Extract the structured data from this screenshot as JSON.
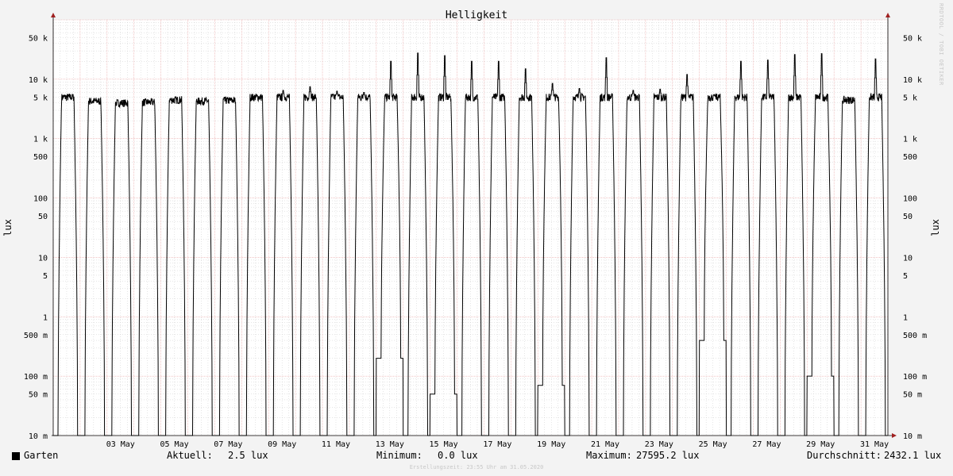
{
  "chart_data": {
    "type": "line",
    "title": "Helligkeit",
    "ylabel_left": "lux",
    "ylabel_right": "lux",
    "y_scale": "log",
    "ylim": [
      0.01,
      100000
    ],
    "y_ticks": [
      {
        "value": 0.01,
        "label": "10 m"
      },
      {
        "value": 0.05,
        "label": "50 m"
      },
      {
        "value": 0.1,
        "label": "100 m"
      },
      {
        "value": 0.5,
        "label": "500 m"
      },
      {
        "value": 1,
        "label": "1"
      },
      {
        "value": 5,
        "label": "5"
      },
      {
        "value": 10,
        "label": "10"
      },
      {
        "value": 50,
        "label": "50"
      },
      {
        "value": 100,
        "label": "100"
      },
      {
        "value": 500,
        "label": "500"
      },
      {
        "value": 1000,
        "label": "1 k"
      },
      {
        "value": 5000,
        "label": "5 k"
      },
      {
        "value": 10000,
        "label": "10 k"
      },
      {
        "value": 50000,
        "label": "50 k"
      }
    ],
    "x_start": "2020-05-01",
    "x_end": "2020-06-01",
    "x_ticks": [
      "03 May",
      "05 May",
      "07 May",
      "09 May",
      "11 May",
      "13 May",
      "15 May",
      "17 May",
      "19 May",
      "21 May",
      "23 May",
      "25 May",
      "27 May",
      "29 May",
      "31 May"
    ],
    "grid": true,
    "series": [
      {
        "name": "Garten",
        "color": "#000000",
        "daily": [
          {
            "date": "2020-05-01",
            "peak_lux": 5000,
            "night_lux": 0.01
          },
          {
            "date": "2020-05-02",
            "peak_lux": 4300,
            "night_lux": 0.01
          },
          {
            "date": "2020-05-03",
            "peak_lux": 4000,
            "night_lux": 0.01
          },
          {
            "date": "2020-05-04",
            "peak_lux": 4100,
            "night_lux": 0.01
          },
          {
            "date": "2020-05-05",
            "peak_lux": 4500,
            "night_lux": 0.01
          },
          {
            "date": "2020-05-06",
            "peak_lux": 4300,
            "night_lux": 0.01
          },
          {
            "date": "2020-05-07",
            "peak_lux": 4400,
            "night_lux": 0.01
          },
          {
            "date": "2020-05-08",
            "peak_lux": 5000,
            "night_lux": 0.01
          },
          {
            "date": "2020-05-09",
            "peak_lux": 6500,
            "night_lux": 0.01
          },
          {
            "date": "2020-05-10",
            "peak_lux": 7500,
            "night_lux": 0.01
          },
          {
            "date": "2020-05-11",
            "peak_lux": 6300,
            "night_lux": 0.01
          },
          {
            "date": "2020-05-12",
            "peak_lux": 6000,
            "night_lux": 0.01
          },
          {
            "date": "2020-05-13",
            "peak_lux": 20000,
            "night_lux": 0.2
          },
          {
            "date": "2020-05-14",
            "peak_lux": 27595.2,
            "night_lux": 0.01
          },
          {
            "date": "2020-05-15",
            "peak_lux": 25000,
            "night_lux": 0.05
          },
          {
            "date": "2020-05-16",
            "peak_lux": 20000,
            "night_lux": 0.01
          },
          {
            "date": "2020-05-17",
            "peak_lux": 20000,
            "night_lux": 0.01
          },
          {
            "date": "2020-05-18",
            "peak_lux": 15000,
            "night_lux": 0.01
          },
          {
            "date": "2020-05-19",
            "peak_lux": 8500,
            "night_lux": 0.07
          },
          {
            "date": "2020-05-20",
            "peak_lux": 7000,
            "night_lux": 0.01
          },
          {
            "date": "2020-05-21",
            "peak_lux": 23000,
            "night_lux": 0.01
          },
          {
            "date": "2020-05-22",
            "peak_lux": 6500,
            "night_lux": 0.01
          },
          {
            "date": "2020-05-23",
            "peak_lux": 6800,
            "night_lux": 0.01
          },
          {
            "date": "2020-05-24",
            "peak_lux": 12000,
            "night_lux": 0.01
          },
          {
            "date": "2020-05-25",
            "peak_lux": 5500,
            "night_lux": 0.4
          },
          {
            "date": "2020-05-26",
            "peak_lux": 20000,
            "night_lux": 0.01
          },
          {
            "date": "2020-05-27",
            "peak_lux": 21000,
            "night_lux": 0.01
          },
          {
            "date": "2020-05-28",
            "peak_lux": 26000,
            "night_lux": 0.01
          },
          {
            "date": "2020-05-29",
            "peak_lux": 27000,
            "night_lux": 0.1
          },
          {
            "date": "2020-05-30",
            "peak_lux": 4500,
            "night_lux": 0.01
          },
          {
            "date": "2020-05-31",
            "peak_lux": 22000,
            "night_lux": 0.01
          }
        ]
      }
    ]
  },
  "legend": {
    "series_name": "Garten",
    "aktuell_label": "Aktuell:",
    "aktuell_value": "2.5 lux",
    "minimum_label": "Minimum:",
    "minimum_value": "0.0 lux",
    "maximum_label": "Maximum:",
    "maximum_value": "27595.2 lux",
    "durchschnitt_label": "Durchschnitt:",
    "durchschnitt_value": "2432.1 lux"
  },
  "footer": {
    "creation_time": "Erstellungszeit: 23:55 Uhr am 31.05.2020"
  },
  "watermark": "RRDTOOL / TOBI OETIKER",
  "colors": {
    "background": "#f3f3f3",
    "plot_background": "#ffffff",
    "major_grid": "#e8a0a0",
    "minor_grid": "#cccccc",
    "line": "#000000",
    "axis_arrow": "#a02020"
  }
}
